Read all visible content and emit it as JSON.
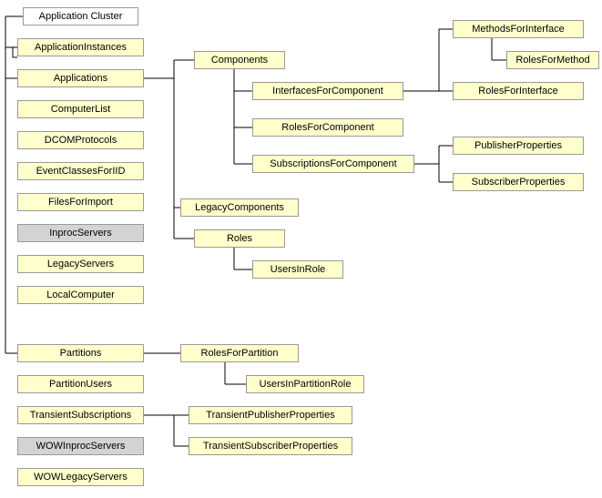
{
  "n": {
    "appCluster": "Application Cluster",
    "appInst": "ApplicationInstances",
    "apps": "Applications",
    "compList": "ComputerList",
    "dcom": "DCOMProtocols",
    "evtCls": "EventClassesForIID",
    "files": "FilesForImport",
    "inproc": "InprocServers",
    "legacySrv": "LegacyServers",
    "localComp": "LocalComputer",
    "partitions": "Partitions",
    "partUsers": "PartitionUsers",
    "transSubs": "TransientSubscriptions",
    "wowInproc": "WOWInprocServers",
    "wowLegacy": "WOWLegacyServers",
    "components": "Components",
    "legacyComp": "LegacyComponents",
    "roles": "Roles",
    "ifc": "InterfacesForComponent",
    "rfc": "RolesForComponent",
    "sfc": "SubscriptionsForComponent",
    "usersRole": "UsersInRole",
    "mfi": "MethodsForInterface",
    "rfi": "RolesForInterface",
    "rfm": "RolesForMethod",
    "pubProp": "PublisherProperties",
    "subProp": "SubscriberProperties",
    "rfp": "RolesForPartition",
    "uipr": "UsersInPartitionRole",
    "tpp": "TransientPublisherProperties",
    "tsp": "TransientSubscriberProperties"
  }
}
